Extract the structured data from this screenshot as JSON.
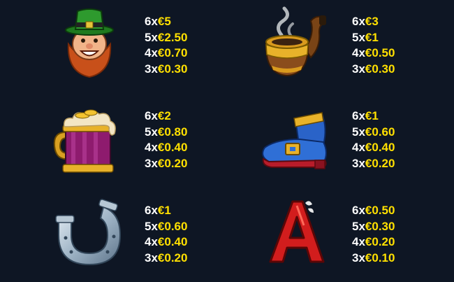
{
  "symbols": [
    {
      "icon": "leprechaun-icon",
      "pays": [
        {
          "count": "6x",
          "value": "€5"
        },
        {
          "count": "5x",
          "value": "€2.50"
        },
        {
          "count": "4x",
          "value": "€0.70"
        },
        {
          "count": "3x",
          "value": "€0.30"
        }
      ]
    },
    {
      "icon": "pipe-icon",
      "pays": [
        {
          "count": "6x",
          "value": "€3"
        },
        {
          "count": "5x",
          "value": "€1"
        },
        {
          "count": "4x",
          "value": "€0.50"
        },
        {
          "count": "3x",
          "value": "€0.30"
        }
      ]
    },
    {
      "icon": "beer-mug-icon",
      "pays": [
        {
          "count": "6x",
          "value": "€2"
        },
        {
          "count": "5x",
          "value": "€0.80"
        },
        {
          "count": "4x",
          "value": "€0.40"
        },
        {
          "count": "3x",
          "value": "€0.20"
        }
      ]
    },
    {
      "icon": "boot-icon",
      "pays": [
        {
          "count": "6x",
          "value": "€1"
        },
        {
          "count": "5x",
          "value": "€0.60"
        },
        {
          "count": "4x",
          "value": "€0.40"
        },
        {
          "count": "3x",
          "value": "€0.20"
        }
      ]
    },
    {
      "icon": "horseshoe-icon",
      "pays": [
        {
          "count": "6x",
          "value": "€1"
        },
        {
          "count": "5x",
          "value": "€0.60"
        },
        {
          "count": "4x",
          "value": "€0.40"
        },
        {
          "count": "3x",
          "value": "€0.20"
        }
      ]
    },
    {
      "icon": "letter-a-icon",
      "pays": [
        {
          "count": "6x",
          "value": "€0.50"
        },
        {
          "count": "5x",
          "value": "€0.30"
        },
        {
          "count": "4x",
          "value": "€0.20"
        },
        {
          "count": "3x",
          "value": "€0.10"
        }
      ]
    }
  ],
  "colors": {
    "background": "#0e1624",
    "count_text": "#ffffff",
    "value_text": "#ffe000"
  }
}
